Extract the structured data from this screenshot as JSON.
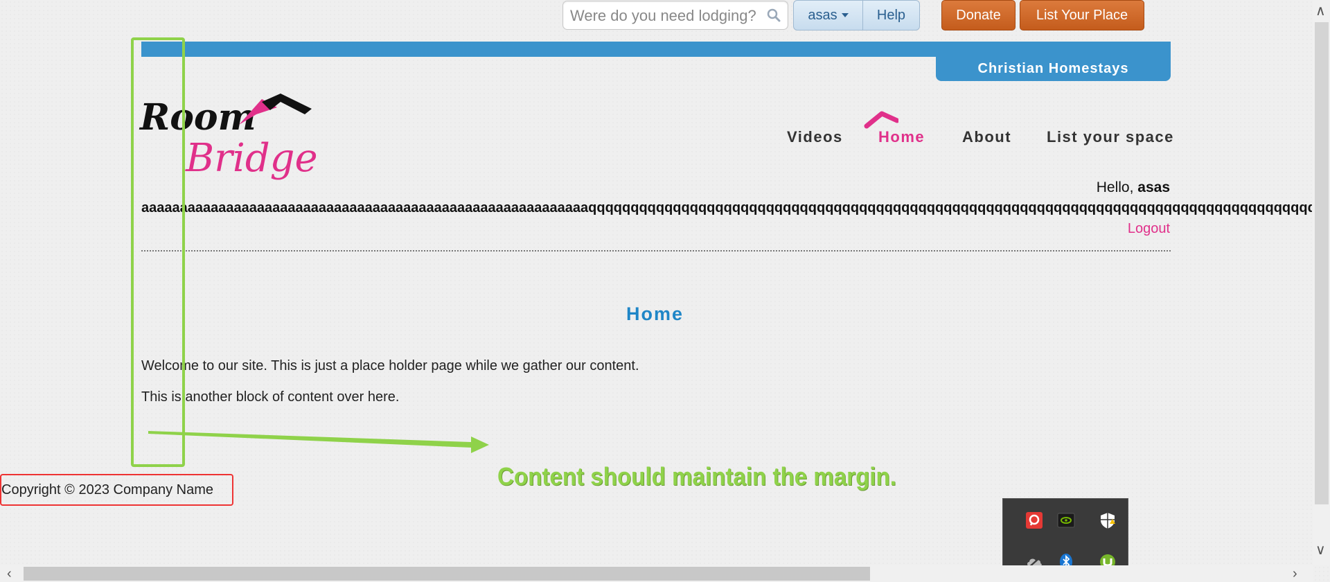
{
  "topbar": {
    "search_placeholder": "Were do you need lodging?",
    "user_label": "asas",
    "help_label": "Help",
    "donate_label": "Donate",
    "list_place_label": "List Your Place"
  },
  "header": {
    "tab_label": "Christian Homestays",
    "logo_text_1": "Room",
    "logo_text_2": "Bridge"
  },
  "nav": {
    "items": [
      {
        "label": "Videos"
      },
      {
        "label": "Home"
      },
      {
        "label": "About"
      },
      {
        "label": "List your space"
      }
    ]
  },
  "greeting": {
    "hello_prefix": "Hello,",
    "username": "asas",
    "long_name": "aaaaaaaaaaaaaaaaaaaaaaaaaaaaaaaaaaaaaaaaaaaaaaaaaaaaaaaaaaqqqqqqqqqqqqqqqqqqqqqqqqqqqqqqqqqqqqqqqqqqqqqqqqqqqqqqqqqqqqqqqqqqqqqqqqqqqqqqqqqqqqqqqqqqqqq",
    "logout_label": "Logout"
  },
  "content": {
    "title": "Home",
    "para1": "Welcome to our site. This is just a place holder page while we gather our content.",
    "para2": "This is another block of content over here."
  },
  "footer": {
    "copyright": "Copyright © 2023 Company Name"
  },
  "annotation": {
    "text": "Content should maintain the margin."
  },
  "colors": {
    "accent_blue": "#3b93cc",
    "accent_pink": "#e0308a",
    "button_orange": "#c45c1c",
    "annotation_green": "#8fd24a",
    "annotation_red": "#e33333"
  },
  "tray": {
    "icons": [
      "pushbullet-icon",
      "nvidia-icon",
      "security-shield-icon",
      "onedrive-icon",
      "bluetooth-icon",
      "utorrent-icon"
    ]
  }
}
